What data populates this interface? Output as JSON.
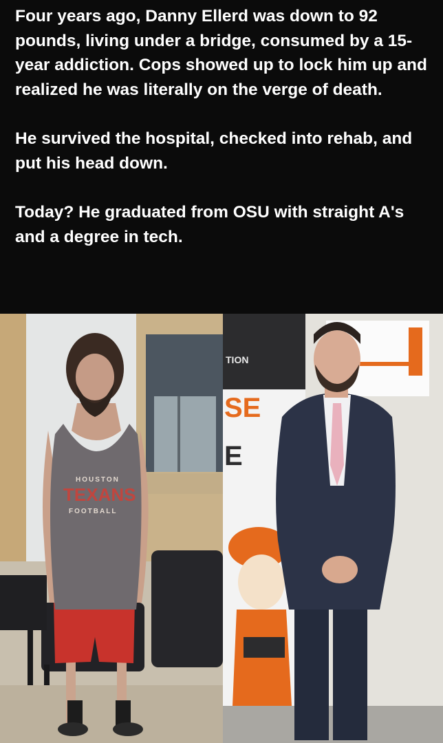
{
  "post": {
    "paragraphs": [
      "Four years ago, Danny Ellerd was down to 92 pounds, living under a bridge, consumed by a 15-year addiction. Cops showed up to lock him up and realized he was literally on the verge of death.",
      "He survived the hospital, checked into rehab, and put his head down.",
      "Today? He graduated from OSU with straight A's and a degree in tech."
    ]
  },
  "photo_before": {
    "shirt_line1": "HOUSTON",
    "shirt_line2": "TEXANS",
    "shirt_line3": "FOOTBALL"
  },
  "photo_after": {
    "banner_text1": "TION",
    "banner_text2": "SE",
    "banner_text3": "E"
  },
  "colors": {
    "background": "#0b0b0b",
    "text": "#ffffff",
    "osu_orange": "#e56a1d",
    "suit": "#2c3347",
    "tie": "#e9b1bd"
  }
}
